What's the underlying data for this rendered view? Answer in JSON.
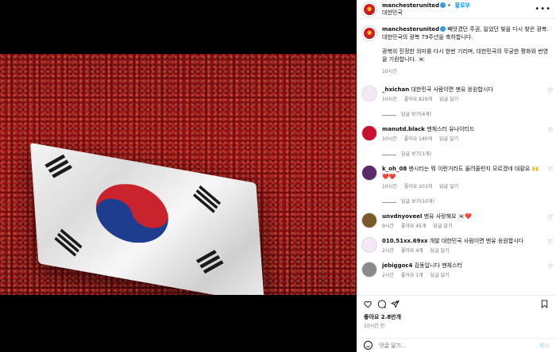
{
  "header": {
    "username": "manchesterunited",
    "follow_label": "팔로우",
    "location": "대한민국",
    "more_label": "•••"
  },
  "caption": {
    "username": "manchesterunited",
    "text_1": "빼앗겼던 주권, 잃었던 빛을 다시 찾은 광복. 대한민국의 광복 79주년을 축하합니다.",
    "text_2": "광복의 진정한 의미를 다시 한번 기리며, 대한민국의 무궁한 평화와 번영을 기원합니다. 🇰🇷",
    "time": "10시간"
  },
  "comments": [
    {
      "username": "_hxichan",
      "text": "대한민국 사람이면 맨유 응원합시다",
      "time": "10시간",
      "likes": "좋아요 829개",
      "reply": "답글 달기",
      "replies": "답글 보기(4개)",
      "avatar_color": "#f5e9f7"
    },
    {
      "username": "manutd.black",
      "text": "맨체스터 유나이티드",
      "time": "10시간",
      "likes": "좋아요 140개",
      "reply": "답글 달기",
      "replies": "답글 보기(1개)",
      "avatar_color": "#c8102e"
    },
    {
      "username": "k_oh_08",
      "text": "맨시티는 뭐 이런거라도 올려줄련지 모르겠네 대황유 🙌❤️❤️",
      "time": "10시간",
      "likes": "좋아요 203개",
      "reply": "답글 달기",
      "replies": "답글 보기(10개)",
      "avatar_color": "#5a2a6a"
    },
    {
      "username": "unvdnyoveel",
      "text": "맨유 사랑해요 🇰🇷❤️",
      "time": "9시간",
      "likes": "좋아요 45개",
      "reply": "답글 달기",
      "replies": "",
      "avatar_color": "#7a5a2a"
    },
    {
      "username": "010.51xx.69xx",
      "text": "개발 대한민국 사람이면 맨유 응원합시다",
      "time": "2시간",
      "likes": "좋아요 4개",
      "reply": "답글 달기",
      "replies": "",
      "avatar_color": "#f5e9f7"
    },
    {
      "username": "jebiggoc4",
      "text": "감동입니다 맨체스터",
      "time": "2시간",
      "likes": "좋아요 1개",
      "reply": "답글 달기",
      "replies": "",
      "avatar_color": "#8a8a8a"
    }
  ],
  "actions": {
    "likes": "좋아요 2.8만개",
    "post_time": "10시간 전",
    "add_comment_placeholder": "댓글 달기...",
    "post_label": "게시"
  }
}
